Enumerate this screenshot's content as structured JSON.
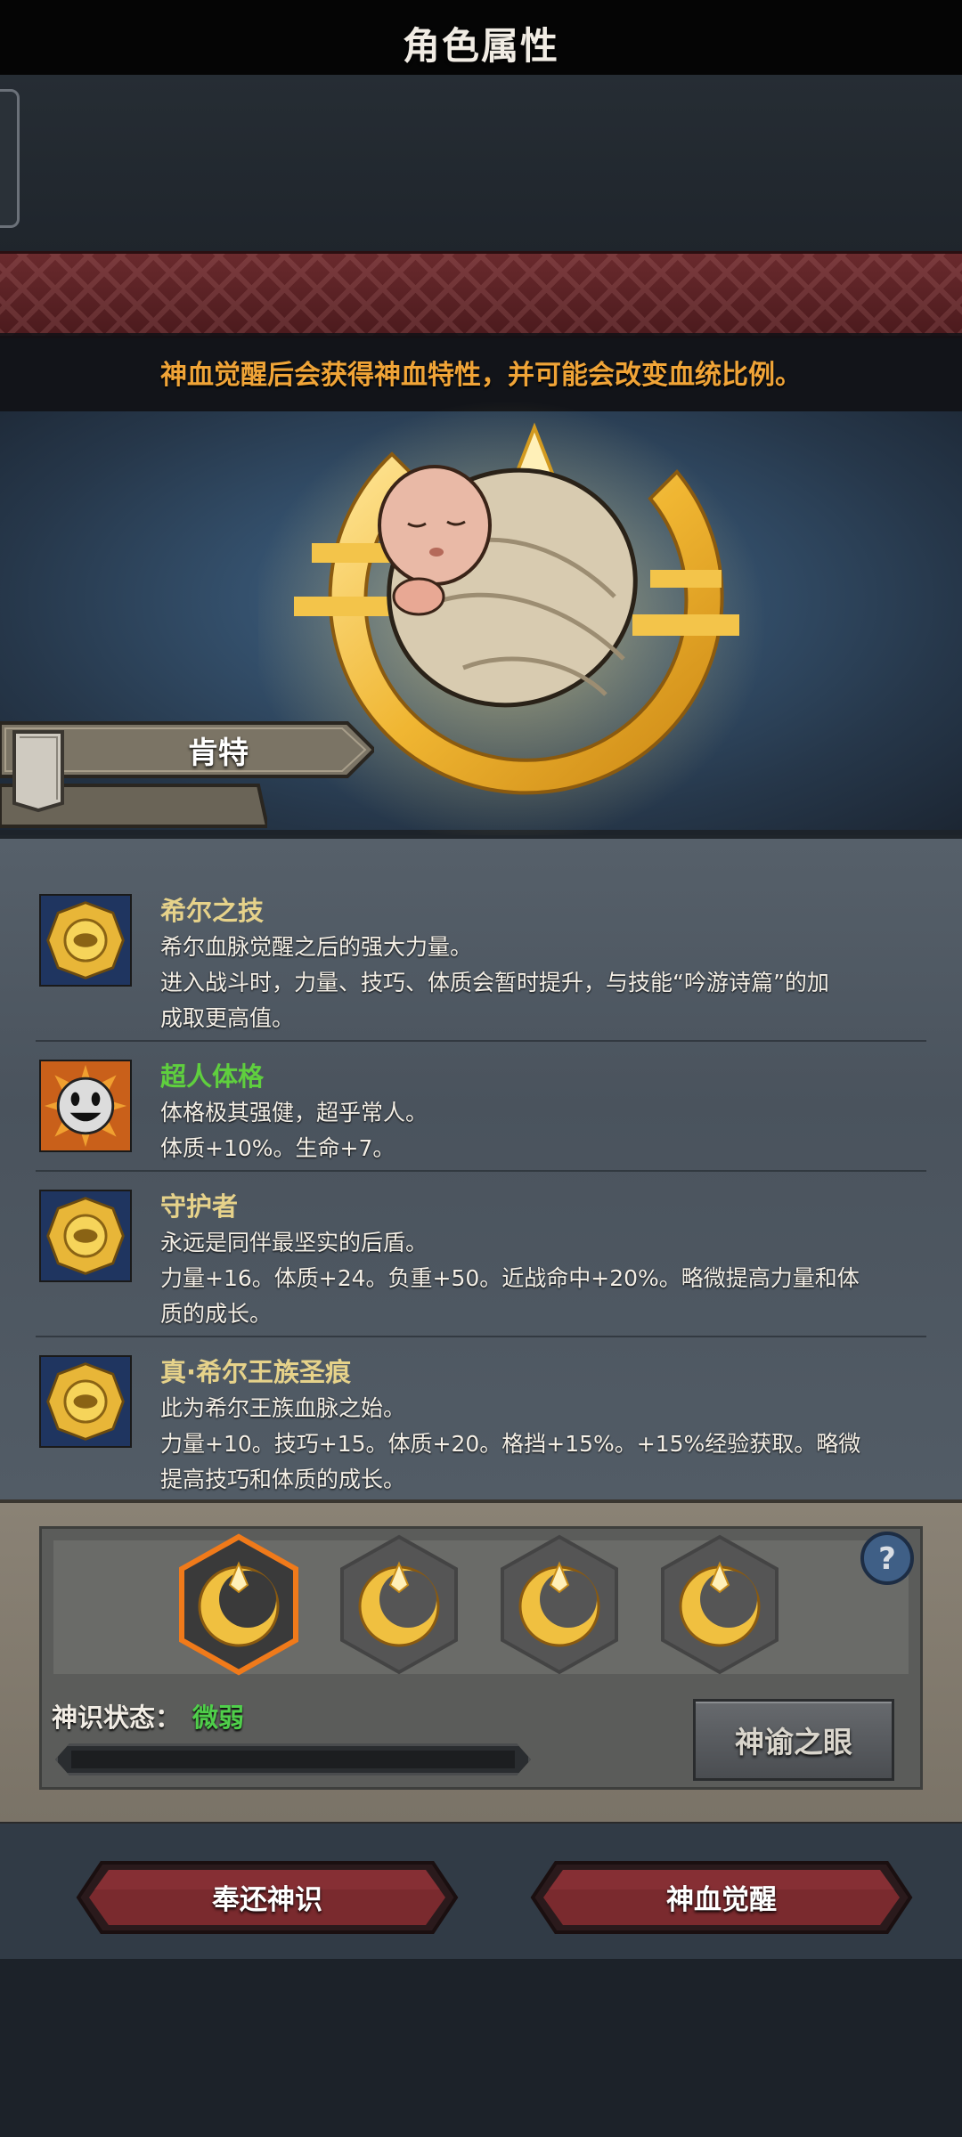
{
  "header": {
    "title": "角色属性",
    "subtitle": "神血觉醒后会获得神血特性，并可能会改变血统比例。"
  },
  "character": {
    "name": "肯特"
  },
  "traits": [
    {
      "name": "希尔之技",
      "name_color": "#e6d28a",
      "icon": "gold-emblem-icon",
      "lines": [
        "希尔血脉觉醒之后的强大力量。",
        "进入战斗时，力量、技巧、体质会暂时提升，与技能“吟游诗篇”的加",
        "成取更高值。"
      ]
    },
    {
      "name": "超人体格",
      "name_color": "#5fcf3e",
      "icon": "smiley-face-icon",
      "lines": [
        "体格极其强健，超乎常人。",
        "体质+10%。生命+7。"
      ]
    },
    {
      "name": "守护者",
      "name_color": "#e6d28a",
      "icon": "gold-emblem-icon",
      "lines": [
        "永远是同伴最坚实的后盾。",
        "力量+16。体质+24。负重+50。近战命中+20%。略微提高力量和体",
        "质的成长。"
      ]
    },
    {
      "name": "真·希尔王族圣痕",
      "name_color": "#e6d28a",
      "icon": "gold-emblem-icon",
      "lines": [
        "此为希尔王族血脉之始。",
        "力量+10。技巧+15。体质+20。格挡+15%。+15%经验获取。略微",
        "提高技巧和体质的成长。"
      ]
    }
  ],
  "awakening": {
    "slots": [
      "crescent-emblem-icon",
      "crescent-emblem-icon",
      "crescent-emblem-icon",
      "crescent-emblem-icon"
    ],
    "selected_index": 0,
    "status_label": "神识状态：",
    "status_value": "微弱",
    "progress": 0,
    "eye_button": "神谕之眼",
    "help_icon": "question-icon"
  },
  "actions": {
    "return_label": "奉还神识",
    "awaken_label": "神血觉醒"
  },
  "colors": {
    "accent_orange": "#f0a437",
    "status_green": "#4fcf4a",
    "button_red": "#7a2a2e"
  }
}
